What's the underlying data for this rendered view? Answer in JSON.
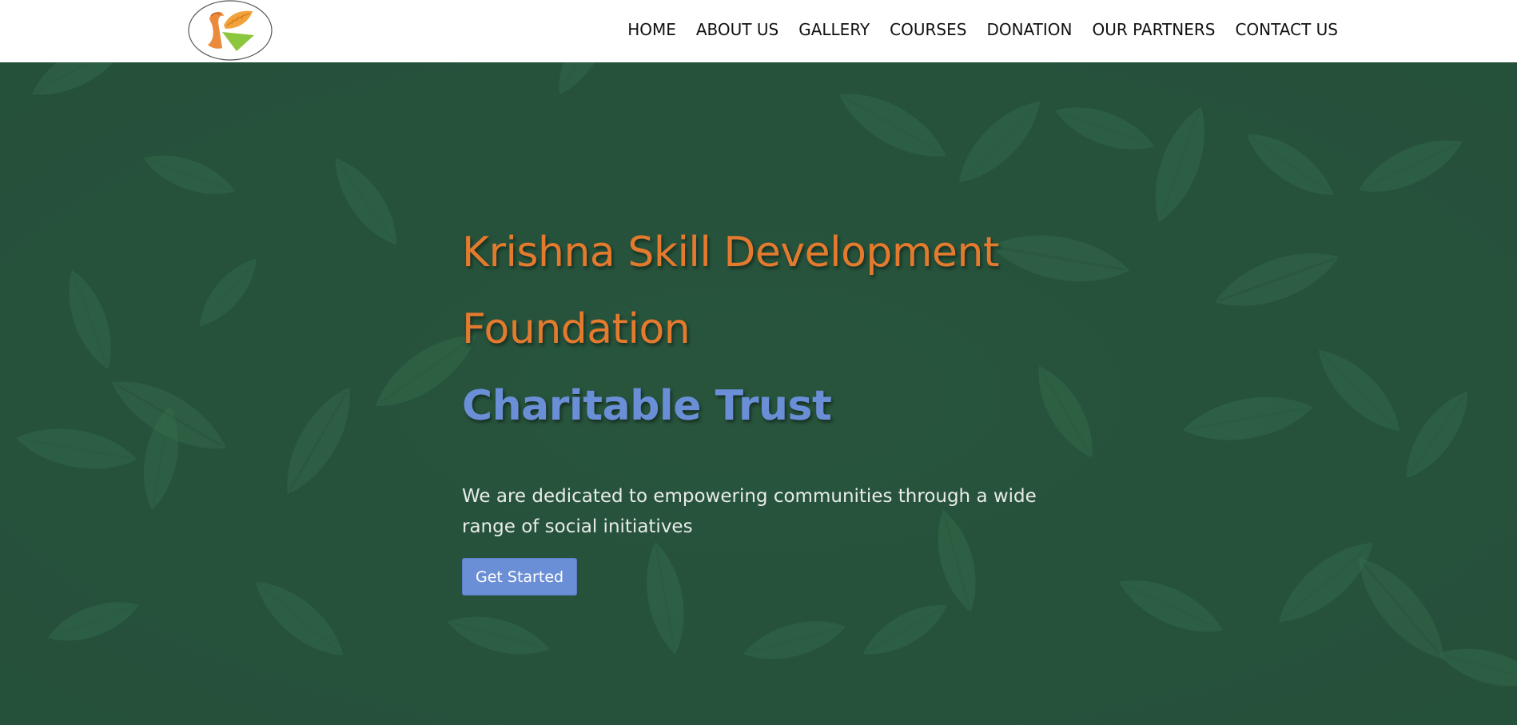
{
  "header": {
    "logo_icon": "krishna-k-logo-icon",
    "nav": [
      {
        "label": "HOME"
      },
      {
        "label": "ABOUT US"
      },
      {
        "label": "GALLERY"
      },
      {
        "label": "COURSES"
      },
      {
        "label": "DONATION"
      },
      {
        "label": "OUR PARTNERS"
      },
      {
        "label": "CONTACT US"
      }
    ]
  },
  "hero": {
    "title_line1": "Krishna Skill Development",
    "title_line2": "Foundation",
    "subtitle": "Charitable Trust",
    "tagline": "We are dedicated to empowering communities through a wide range of social initiatives",
    "cta_label": "Get Started"
  },
  "colors": {
    "title": "#e47a2e",
    "subtitle": "#6b8fd6",
    "cta_bg": "#6b8fd6",
    "hero_bg": "#2f5a44",
    "header_bg": "#ffffff"
  }
}
